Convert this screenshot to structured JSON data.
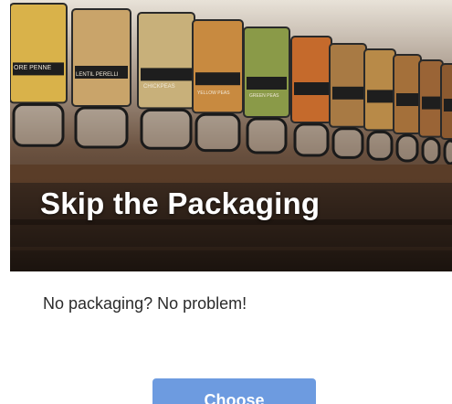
{
  "card": {
    "title": "Skip the Packaging",
    "description": "No packaging? No problem!",
    "button_label": "Choose",
    "accent_color": "#6d9be0"
  },
  "hero": {
    "jar_labels": [
      "ORE PENNE",
      "LENTIL PERELLI",
      "CHICKPEAS",
      "YELLOW PEAS",
      "GREEN PEAS"
    ]
  }
}
